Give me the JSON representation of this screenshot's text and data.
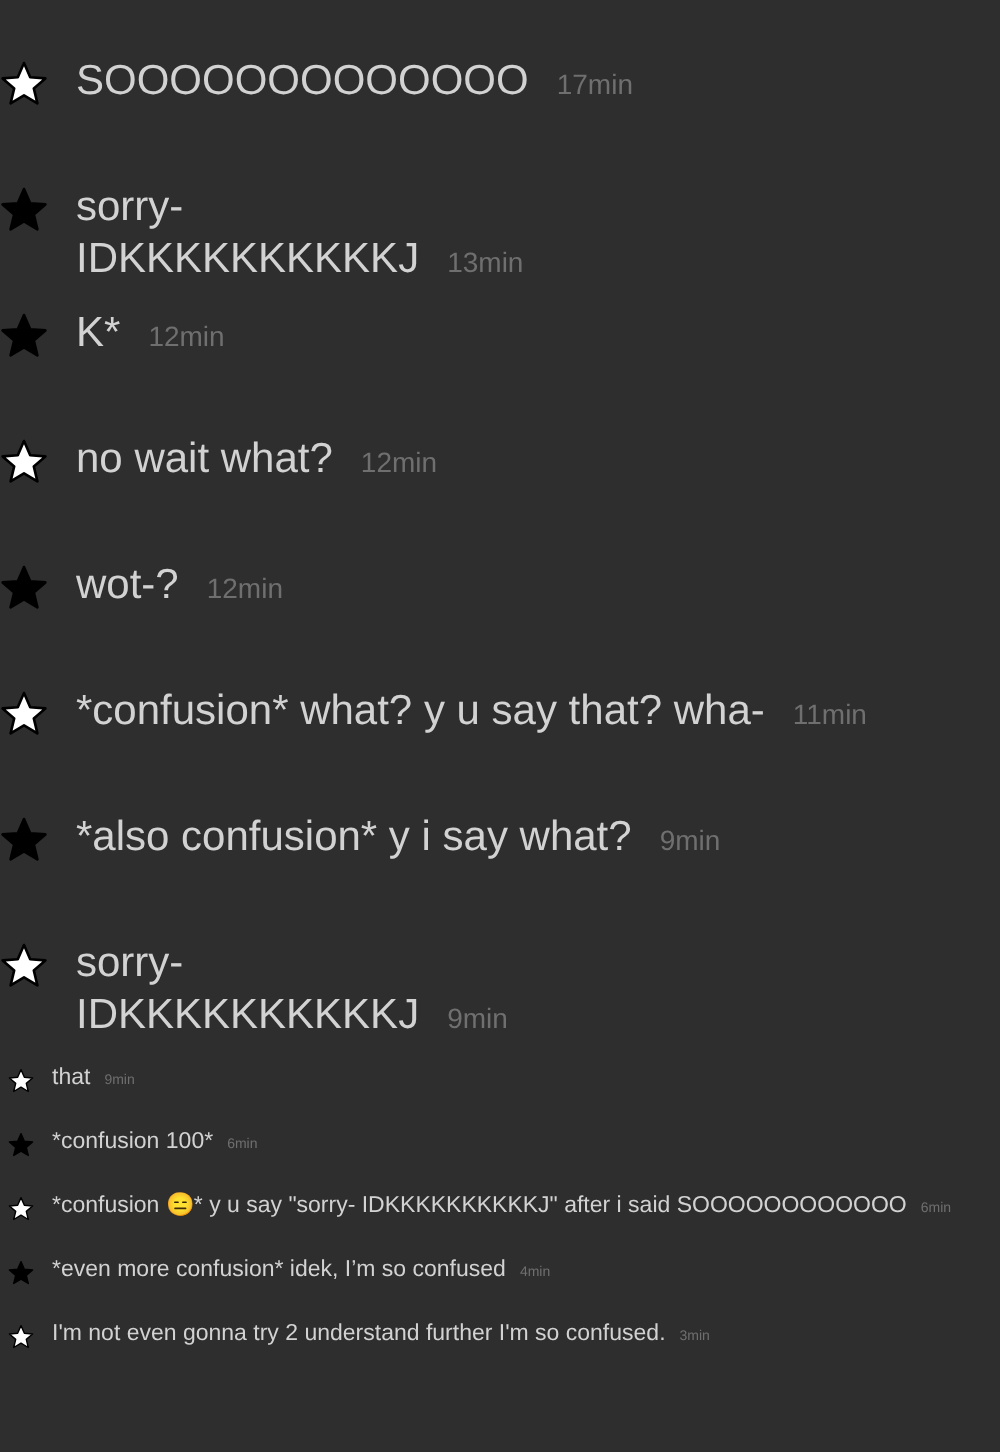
{
  "messages": [
    {
      "kind": "large",
      "color": "#ffffff",
      "lines": [
        "SOOOOOOOOOOOOO"
      ],
      "time": "17min"
    },
    {
      "kind": "large",
      "color": "#000000",
      "lines": [
        "sorry-",
        "IDKKKKKKKKKKJ"
      ],
      "time": "13min"
    },
    {
      "kind": "large",
      "color": "#000000",
      "lines": [
        "K*"
      ],
      "time": "12min"
    },
    {
      "kind": "large",
      "color": "#ffffff",
      "lines": [
        "no wait what?"
      ],
      "time": "12min"
    },
    {
      "kind": "large",
      "color": "#000000",
      "lines": [
        "wot-?"
      ],
      "time": "12min"
    },
    {
      "kind": "large",
      "color": "#ffffff",
      "lines": [
        "*confusion* what? y u say that? wha-"
      ],
      "time": "11min"
    },
    {
      "kind": "large",
      "color": "#000000",
      "lines": [
        "*also confusion* y i say what?"
      ],
      "time": "9min"
    },
    {
      "kind": "large",
      "color": "#ffffff",
      "lines": [
        "sorry-",
        "IDKKKKKKKKKKJ"
      ],
      "time": "9min"
    },
    {
      "kind": "small",
      "color": "#ffffff",
      "lines": [
        "that"
      ],
      "time": "9min"
    },
    {
      "kind": "small",
      "color": "#000000",
      "lines": [
        "*confusion 100*"
      ],
      "time": "6min"
    },
    {
      "kind": "small",
      "color": "#ffffff",
      "lines": [
        "*confusion 😑* y u say \"sorry- IDKKKKKKKKKKJ\" after i said SOOOOOOOOOOOO"
      ],
      "time": "6min"
    },
    {
      "kind": "small",
      "color": "#000000",
      "lines": [
        "*even more confusion* idek, I’m so confused"
      ],
      "time": "4min"
    },
    {
      "kind": "small",
      "color": "#ffffff",
      "lines": [
        "I'm not even gonna try 2 understand further I'm so confused."
      ],
      "time": "3min"
    }
  ]
}
